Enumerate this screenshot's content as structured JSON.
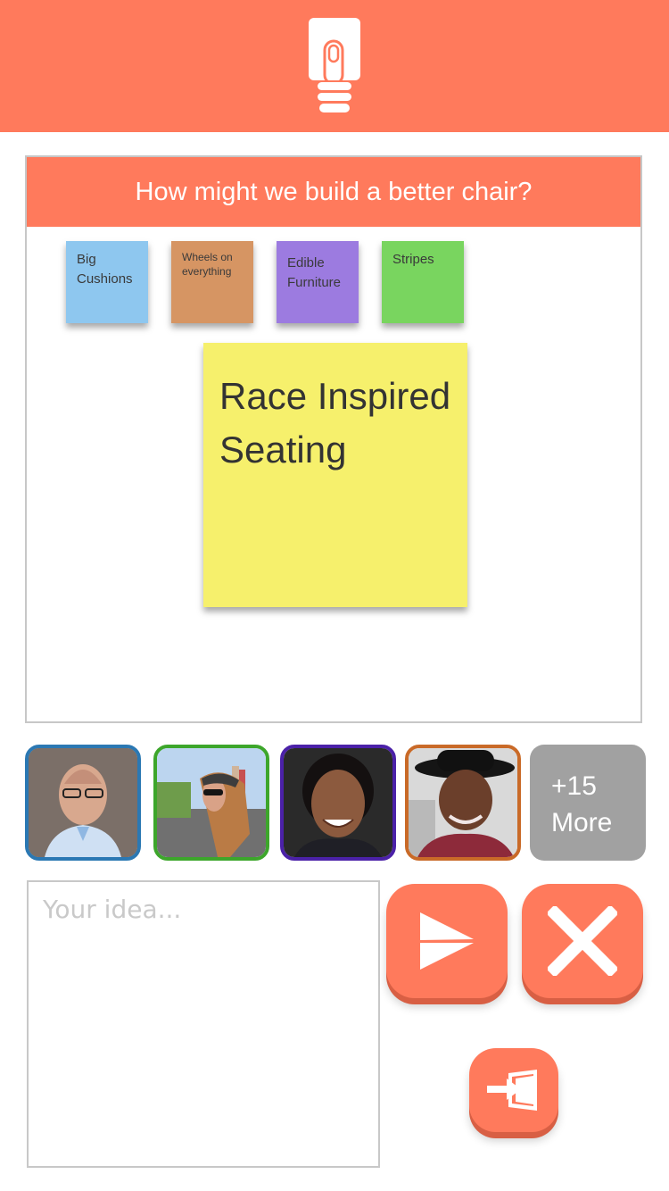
{
  "header": {
    "logo_icon": "lightbulb-icon",
    "color": "#ff7a5c"
  },
  "board": {
    "title": "How might we build a better chair?",
    "notes": [
      {
        "text": "Big Cushions",
        "color": "#8ec7ef"
      },
      {
        "text": "Wheels on everything",
        "color": "#d69563"
      },
      {
        "text": "Edible Furniture",
        "color": "#9c7be0"
      },
      {
        "text": "Stripes",
        "color": "#79d55f"
      }
    ],
    "featured_note": {
      "text": "Race Inspired Seating",
      "color": "#f6f06c"
    }
  },
  "participants": {
    "avatars": [
      {
        "name": "participant-1",
        "border": "#2b78b3"
      },
      {
        "name": "participant-2",
        "border": "#3da62b"
      },
      {
        "name": "participant-3",
        "border": "#4b21a8"
      },
      {
        "name": "participant-4",
        "border": "#c96a28"
      }
    ],
    "more_count": "+15",
    "more_label": "More"
  },
  "composer": {
    "placeholder": "Your idea...",
    "value": "",
    "send_icon": "send-icon",
    "cancel_icon": "close-icon",
    "exit_icon": "exit-door-icon"
  }
}
